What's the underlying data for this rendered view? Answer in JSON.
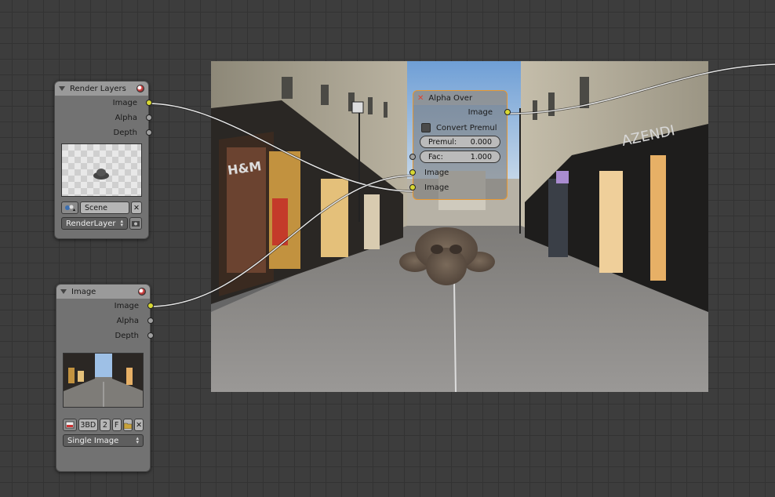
{
  "render_layers": {
    "title": "Render Layers",
    "outputs": [
      "Image",
      "Alpha",
      "Depth"
    ],
    "scene_label": "Scene",
    "layer_label": "RenderLayer"
  },
  "image_node": {
    "title": "Image",
    "outputs": [
      "Image",
      "Alpha",
      "Depth"
    ],
    "image_name": "3BD",
    "users": "2",
    "fake_user": "F",
    "source": "Single Image"
  },
  "alpha_over": {
    "title": "Alpha Over",
    "output": "Image",
    "convert_premul_label": "Convert Premul",
    "premul_label": "Premul:",
    "premul_value": "0.000",
    "fac_label": "Fac:",
    "fac_value": "1.000",
    "inputs": [
      "Image",
      "Image"
    ]
  },
  "backdrop": {
    "store_sign": "AZENDI",
    "store_sign_2": "H&M"
  },
  "colors": {
    "socket_image": "#d8d833",
    "socket_value": "#a0a0a0",
    "active_node_border": "#e8972f"
  }
}
